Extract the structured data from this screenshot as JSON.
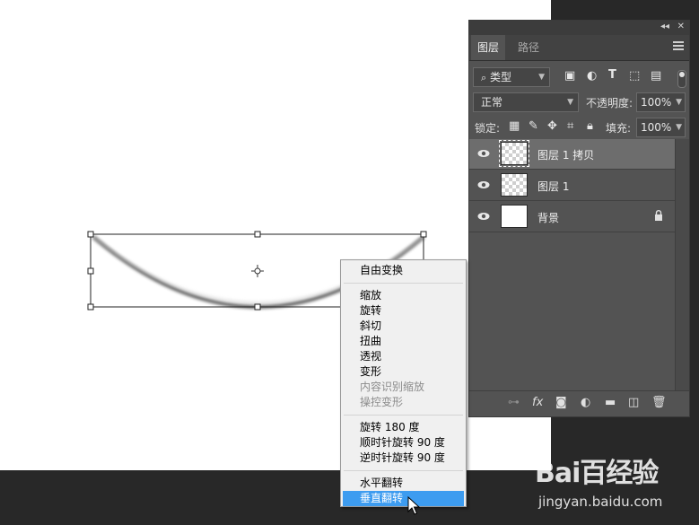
{
  "layers_panel": {
    "tabs": [
      {
        "label": "图层"
      },
      {
        "label": "路径"
      }
    ],
    "filter": {
      "kind_label": "类型"
    },
    "blend": {
      "mode": "正常",
      "opacity_label": "不透明度:",
      "opacity_value": "100%"
    },
    "lock": {
      "label": "锁定:",
      "fill_label": "填充:",
      "fill_value": "100%"
    },
    "layers": [
      {
        "name": "图层 1 拷贝",
        "thumb": "transparent",
        "selected": true
      },
      {
        "name": "图层 1",
        "thumb": "transparent",
        "selected": false
      },
      {
        "name": "背景",
        "thumb": "white",
        "selected": false,
        "locked": true
      }
    ]
  },
  "context_menu": {
    "group1": [
      "自由变换"
    ],
    "group2": [
      "缩放",
      "旋转",
      "斜切",
      "扭曲",
      "透视",
      "变形"
    ],
    "group2_disabled": [
      "内容识别缩放",
      "操控变形"
    ],
    "group3": [
      "旋转 180 度",
      "顺时针旋转 90 度",
      "逆时针旋转 90 度"
    ],
    "group4": [
      "水平翻转",
      "垂直翻转"
    ],
    "highlighted": "垂直翻转"
  },
  "watermark": {
    "logo": "Bai百经验",
    "url": "jingyan.baidu.com"
  },
  "colors": {
    "panel_bg": "#535353",
    "menu_highlight": "#3d9cf0",
    "canvas": "#ffffff"
  }
}
